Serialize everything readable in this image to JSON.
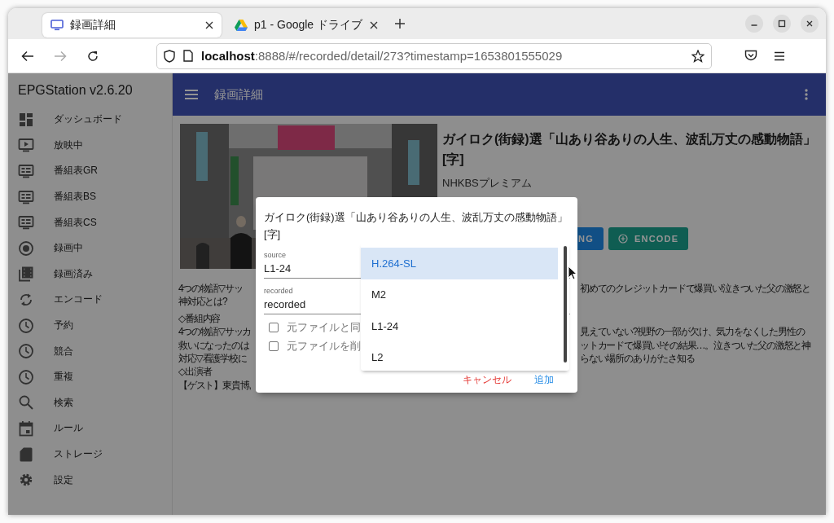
{
  "browser": {
    "tabs": [
      {
        "title": "録画詳細",
        "selected": true
      },
      {
        "title": "p1 - Google ドライブ",
        "selected": false
      }
    ],
    "url": "**localhost**:8888/#/recorded/detail/273?timestamp=1653801555029"
  },
  "sidebar": {
    "title": "EPGStation v2.6.20",
    "items": [
      {
        "label": "ダッシュボード",
        "kind": "dashboard"
      },
      {
        "label": "放映中",
        "kind": "tv"
      },
      {
        "label": "番組表GR",
        "kind": "guide"
      },
      {
        "label": "番組表BS",
        "kind": "guide"
      },
      {
        "label": "番組表CS",
        "kind": "guide"
      },
      {
        "label": "録画中",
        "kind": "record"
      },
      {
        "label": "録画済み",
        "kind": "library"
      },
      {
        "label": "エンコード",
        "kind": "sync"
      },
      {
        "label": "予約",
        "kind": "clock"
      },
      {
        "label": "競合",
        "kind": "clock"
      },
      {
        "label": "重複",
        "kind": "clock"
      },
      {
        "label": "検索",
        "kind": "search"
      },
      {
        "label": "ルール",
        "kind": "calendar"
      },
      {
        "label": "ストレージ",
        "kind": "sdcard"
      },
      {
        "label": "設定",
        "kind": "gear"
      }
    ]
  },
  "app_bar": {
    "title": "録画詳細"
  },
  "program": {
    "title": "ガイロク(街録)選「山あり谷ありの人生、波乱万丈の感動物語」[字]",
    "channel": "NHKBSプレミアム",
    "buttons": [
      {
        "label": "NG",
        "kind": "plain"
      },
      {
        "label": "ENCODE",
        "kind": "encode"
      }
    ],
    "description_paragraphs": [
      [
        {
          "left": "4つの物語▽サッ",
          "right": "初めてのクレジットカードで爆買い!泣きついた父の激怒と"
        },
        {
          "left": "神対応とは?"
        }
      ],
      [
        {
          "left": "◇番組内容"
        },
        {
          "left": "4つの物語▽サッカ",
          "right": "見えていない?視野の一部が欠け、気力をなくした男性の"
        },
        {
          "left": "救いになったのは",
          "right": "ットカードで爆買い!その結果…。泣きついた父の激怒と神"
        },
        {
          "left": "対応▽看護学校に",
          "right": "らない場所のありがたさ知る"
        },
        {
          "left": "◇出演者"
        },
        {
          "left": "【ゲスト】東貴博,"
        }
      ]
    ]
  },
  "dialog": {
    "title": "ガイロク(街録)選「山あり谷ありの人生、波乱万丈の感動物語」[字]",
    "fields": [
      {
        "label": "source",
        "value": "L1-24"
      },
      {
        "label": "recorded",
        "value": "recorded"
      }
    ],
    "checkboxes": [
      {
        "label": "元ファイルと同",
        "checked": false
      },
      {
        "label": "元ファイルを削",
        "checked": false
      }
    ],
    "actions": [
      {
        "label": "キャンセル",
        "kind": "cancel"
      },
      {
        "label": "追加",
        "kind": "confirm"
      }
    ]
  },
  "dropdown": {
    "options": [
      {
        "label": "H.264-SL",
        "selected": true
      },
      {
        "label": "M2",
        "selected": false
      },
      {
        "label": "L1-24",
        "selected": false
      },
      {
        "label": "L2",
        "selected": false
      }
    ]
  }
}
